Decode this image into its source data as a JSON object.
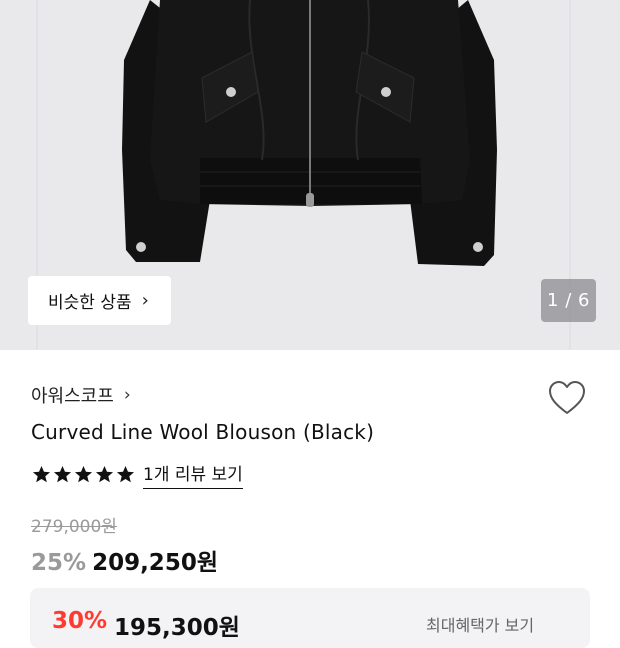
{
  "gallery": {
    "similar_button_label": "비슷한 상품",
    "similar_chevron": "›",
    "counter": "1 / 6",
    "current_index": 1,
    "total_images": 6,
    "background_color": "#e9e9ec",
    "product_color": "#111111"
  },
  "product": {
    "brand": "아워스코프",
    "brand_chevron": "›",
    "title": "Curved Line Wool Blouson (Black)",
    "rating": 5,
    "rating_max": 5,
    "review_link": "1개 리뷰 보기",
    "original_price": "279,000원",
    "discount_rate": "25%",
    "sale_price": "209,250원",
    "wishlist_icon": "heart-outline-icon"
  },
  "benefit": {
    "discount_rate": "30%",
    "price": "195,300원",
    "note": "최대혜택가 보기"
  },
  "colors": {
    "star": "#111111",
    "discount_gray": "#9a9a9a",
    "accent_red": "#ff3b30"
  }
}
